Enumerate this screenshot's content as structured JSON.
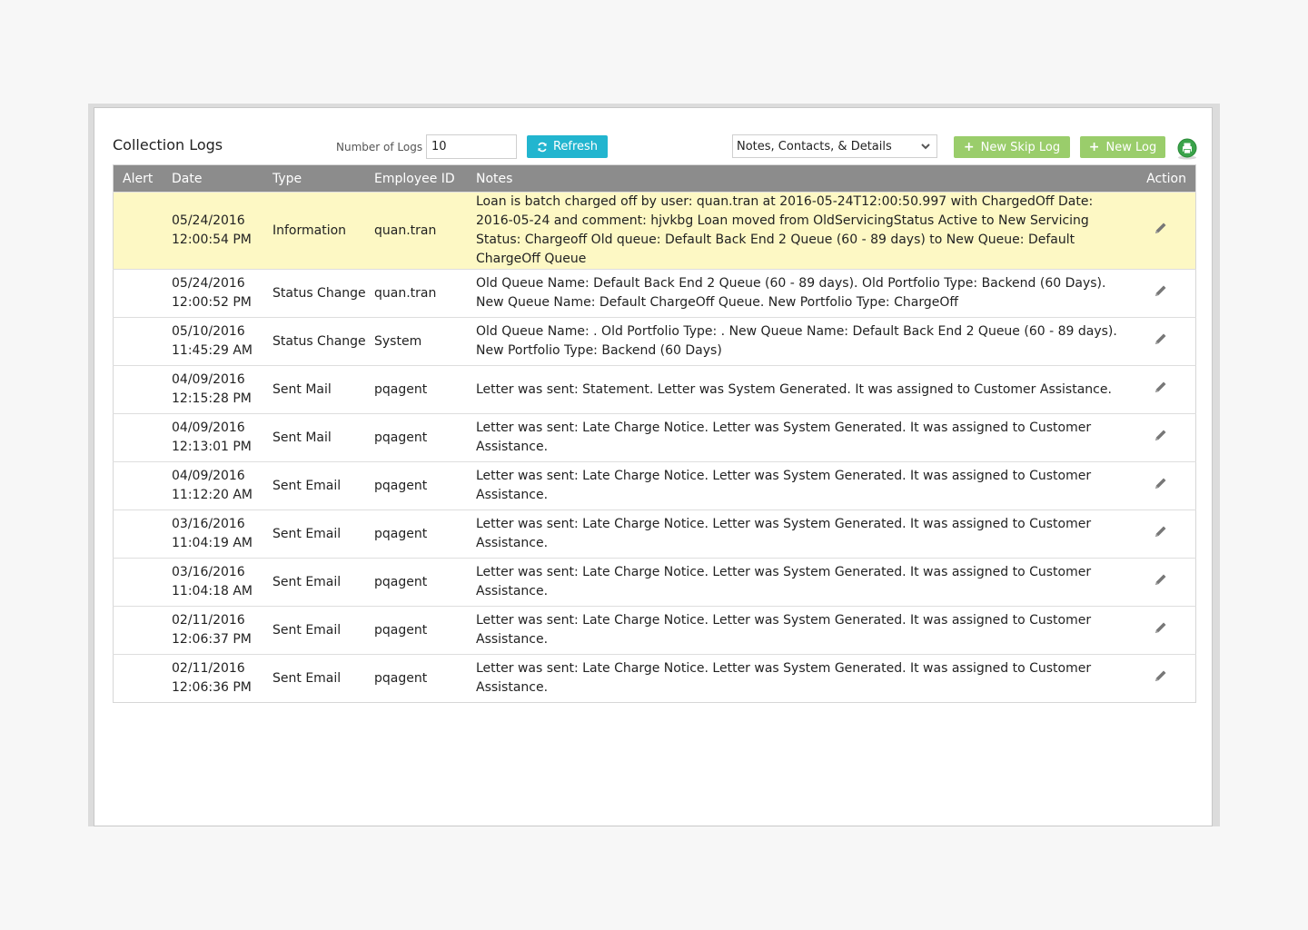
{
  "panel": {
    "title": "Collection Logs",
    "num_logs_label": "Number of Logs",
    "num_logs_value": "10",
    "refresh_label": "Refresh",
    "filter_selected": "Notes, Contacts, & Details",
    "new_skip_log_label": "New Skip Log",
    "new_log_label": "New Log"
  },
  "table": {
    "headers": {
      "alert": "Alert",
      "date": "Date",
      "type": "Type",
      "employee": "Employee ID",
      "notes": "Notes",
      "action": "Action"
    },
    "rows": [
      {
        "date": "05/24/2016",
        "time": "12:00:54 PM",
        "type": "Information",
        "employee": "quan.tran",
        "notes": "Loan is batch charged off by user: quan.tran at 2016-05-24T12:00:50.997 with ChargedOff Date: 2016-05-24 and comment: hjvkbg Loan moved from OldServicingStatus Active to New Servicing Status: Chargeoff Old queue: Default Back End 2 Queue (60 - 89 days) to New Queue: Default ChargeOff Queue"
      },
      {
        "date": "05/24/2016",
        "time": "12:00:52 PM",
        "type": "Status Change",
        "employee": "quan.tran",
        "notes": "Old Queue Name: Default Back End 2 Queue (60 - 89 days). Old Portfolio Type: Backend (60 Days). New Queue Name: Default ChargeOff Queue. New Portfolio Type: ChargeOff"
      },
      {
        "date": "05/10/2016",
        "time": "11:45:29 AM",
        "type": "Status Change",
        "employee": "System",
        "notes": "Old Queue Name: . Old Portfolio Type: . New Queue Name: Default Back End 2 Queue (60 - 89 days). New Portfolio Type: Backend (60 Days)"
      },
      {
        "date": "04/09/2016",
        "time": "12:15:28 PM",
        "type": "Sent Mail",
        "employee": "pqagent",
        "notes": "Letter was sent: Statement. Letter was System Generated. It was assigned to Customer Assistance."
      },
      {
        "date": "04/09/2016",
        "time": "12:13:01 PM",
        "type": "Sent Mail",
        "employee": "pqagent",
        "notes": "Letter was sent: Late Charge Notice. Letter was System Generated. It was assigned to Customer Assistance."
      },
      {
        "date": "04/09/2016",
        "time": "11:12:20 AM",
        "type": "Sent Email",
        "employee": "pqagent",
        "notes": "Letter was sent: Late Charge Notice. Letter was System Generated. It was assigned to Customer Assistance."
      },
      {
        "date": "03/16/2016",
        "time": "11:04:19 AM",
        "type": "Sent Email",
        "employee": "pqagent",
        "notes": "Letter was sent: Late Charge Notice. Letter was System Generated. It was assigned to Customer Assistance."
      },
      {
        "date": "03/16/2016",
        "time": "11:04:18 AM",
        "type": "Sent Email",
        "employee": "pqagent",
        "notes": "Letter was sent: Late Charge Notice. Letter was System Generated. It was assigned to Customer Assistance."
      },
      {
        "date": "02/11/2016",
        "time": "12:06:37 PM",
        "type": "Sent Email",
        "employee": "pqagent",
        "notes": "Letter was sent: Late Charge Notice. Letter was System Generated. It was assigned to Customer Assistance."
      },
      {
        "date": "02/11/2016",
        "time": "12:06:36 PM",
        "type": "Sent Email",
        "employee": "pqagent",
        "notes": "Letter was sent: Late Charge Notice. Letter was System Generated. It was assigned to Customer Assistance."
      }
    ]
  },
  "icons": {
    "refresh": "refresh-icon",
    "dropdown": "chevron-down-icon",
    "plus": "plus-icon",
    "print": "printer-icon",
    "edit": "pencil-icon"
  },
  "colors": {
    "refresh_button": "#22b5cf",
    "green_button": "#9acd6b",
    "header_bg": "#8c8c8c",
    "highlight_row": "#fdf8c4",
    "print_icon": "#3aa34a"
  }
}
